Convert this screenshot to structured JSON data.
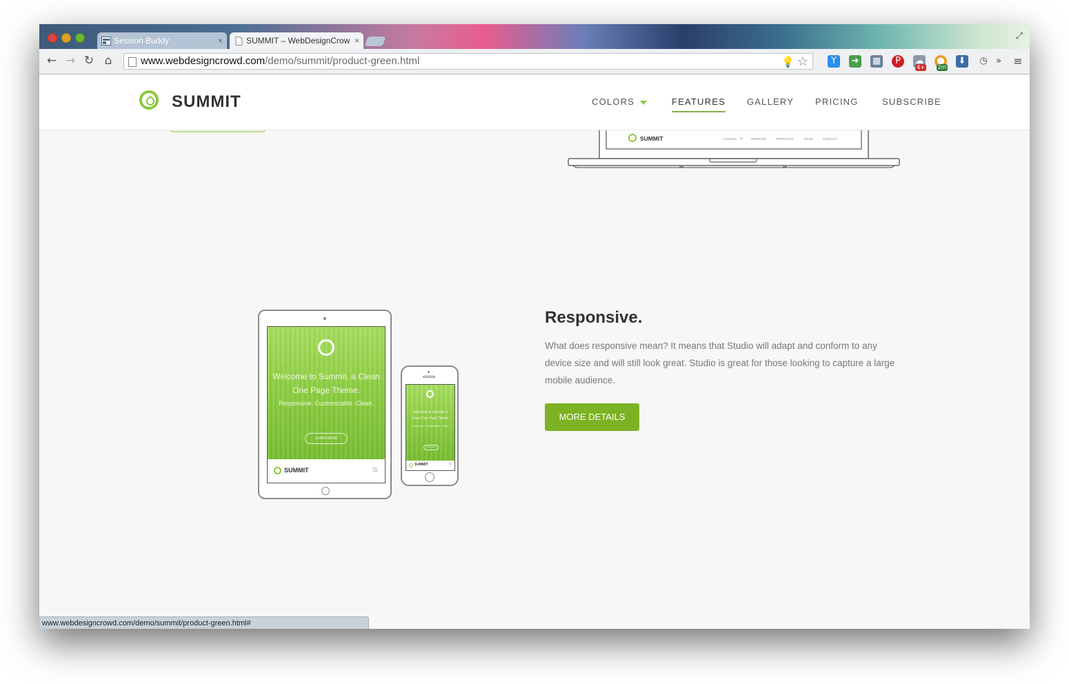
{
  "browser": {
    "tabs": [
      {
        "label": "Session Buddy",
        "close": "×"
      },
      {
        "label": "SUMMIT – WebDesignCrow",
        "close": "×"
      }
    ],
    "url_domain": "www.webdesigncrowd.com",
    "url_path": "/demo/summit/product-green.html",
    "status_url": "www.webdesigncrowd.com/demo/summit/product-green.html#",
    "overflow_label": "»",
    "badges": {
      "ext_count": "4+",
      "ext_time": "2m"
    },
    "icons": [
      "back-icon",
      "forward-icon",
      "reload-icon",
      "home-icon",
      "page-icon",
      "bulb-icon",
      "star-icon",
      "ext-icon",
      "pinterest-icon",
      "weather-icon",
      "clock-icon",
      "menu-icon"
    ]
  },
  "site": {
    "brand": "SUMMIT",
    "nav": {
      "colors": "COLORS",
      "features": "FEATURES",
      "gallery": "GALLERY",
      "pricing": "PRICING",
      "subscribe": "SUBSCRIBE"
    },
    "laptop_preview": {
      "brand": "SUMMIT",
      "links": [
        "COLORS",
        "SERVICES",
        "PORTFOLIO",
        "TEAM",
        "CONTACT"
      ]
    },
    "section": {
      "heading": "Responsive.",
      "body": "What does responsive mean? It means that Studio will adapt and conform to any device size and will still look great. Studio is great for those looking to capture a large mobile audience.",
      "button": "MORE DETAILS"
    },
    "device_mock": {
      "headline": "Welcome to Summit, a Clean One Page Theme.",
      "tagline": "Responsive. Customizable. Clean.",
      "button": "LEARN MORE",
      "brand": "SUMMIT"
    }
  },
  "colors": {
    "accent": "#8dc63f",
    "button": "#7cb224"
  }
}
